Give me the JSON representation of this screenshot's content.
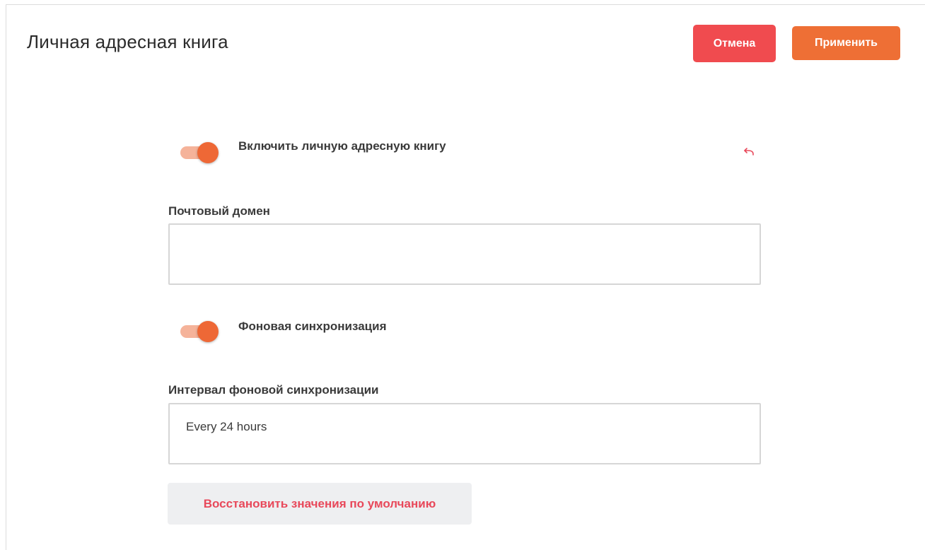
{
  "header": {
    "title": "Личная адресная книга",
    "cancel_label": "Отмена",
    "apply_label": "Применить"
  },
  "settings": {
    "enable_address_book": {
      "label": "Включить личную адресную книгу",
      "enabled": true,
      "reset_icon": "undo-arrow-icon"
    },
    "mail_domain": {
      "label": "Почтовый домен",
      "value": ""
    },
    "background_sync": {
      "label": "Фоновая синхронизация",
      "enabled": true
    },
    "sync_interval": {
      "label": "Интервал фоновой синхронизации",
      "value": "Every 24 hours"
    },
    "restore_defaults_label": "Восстановить значения по умолчанию"
  },
  "colors": {
    "cancel": "#f04b4f",
    "apply": "#ee6f35",
    "toggle_knob": "#ee6836",
    "toggle_track": "#f5b39a",
    "reset_text": "#e8485a",
    "undo_icon": "#e8485a"
  }
}
